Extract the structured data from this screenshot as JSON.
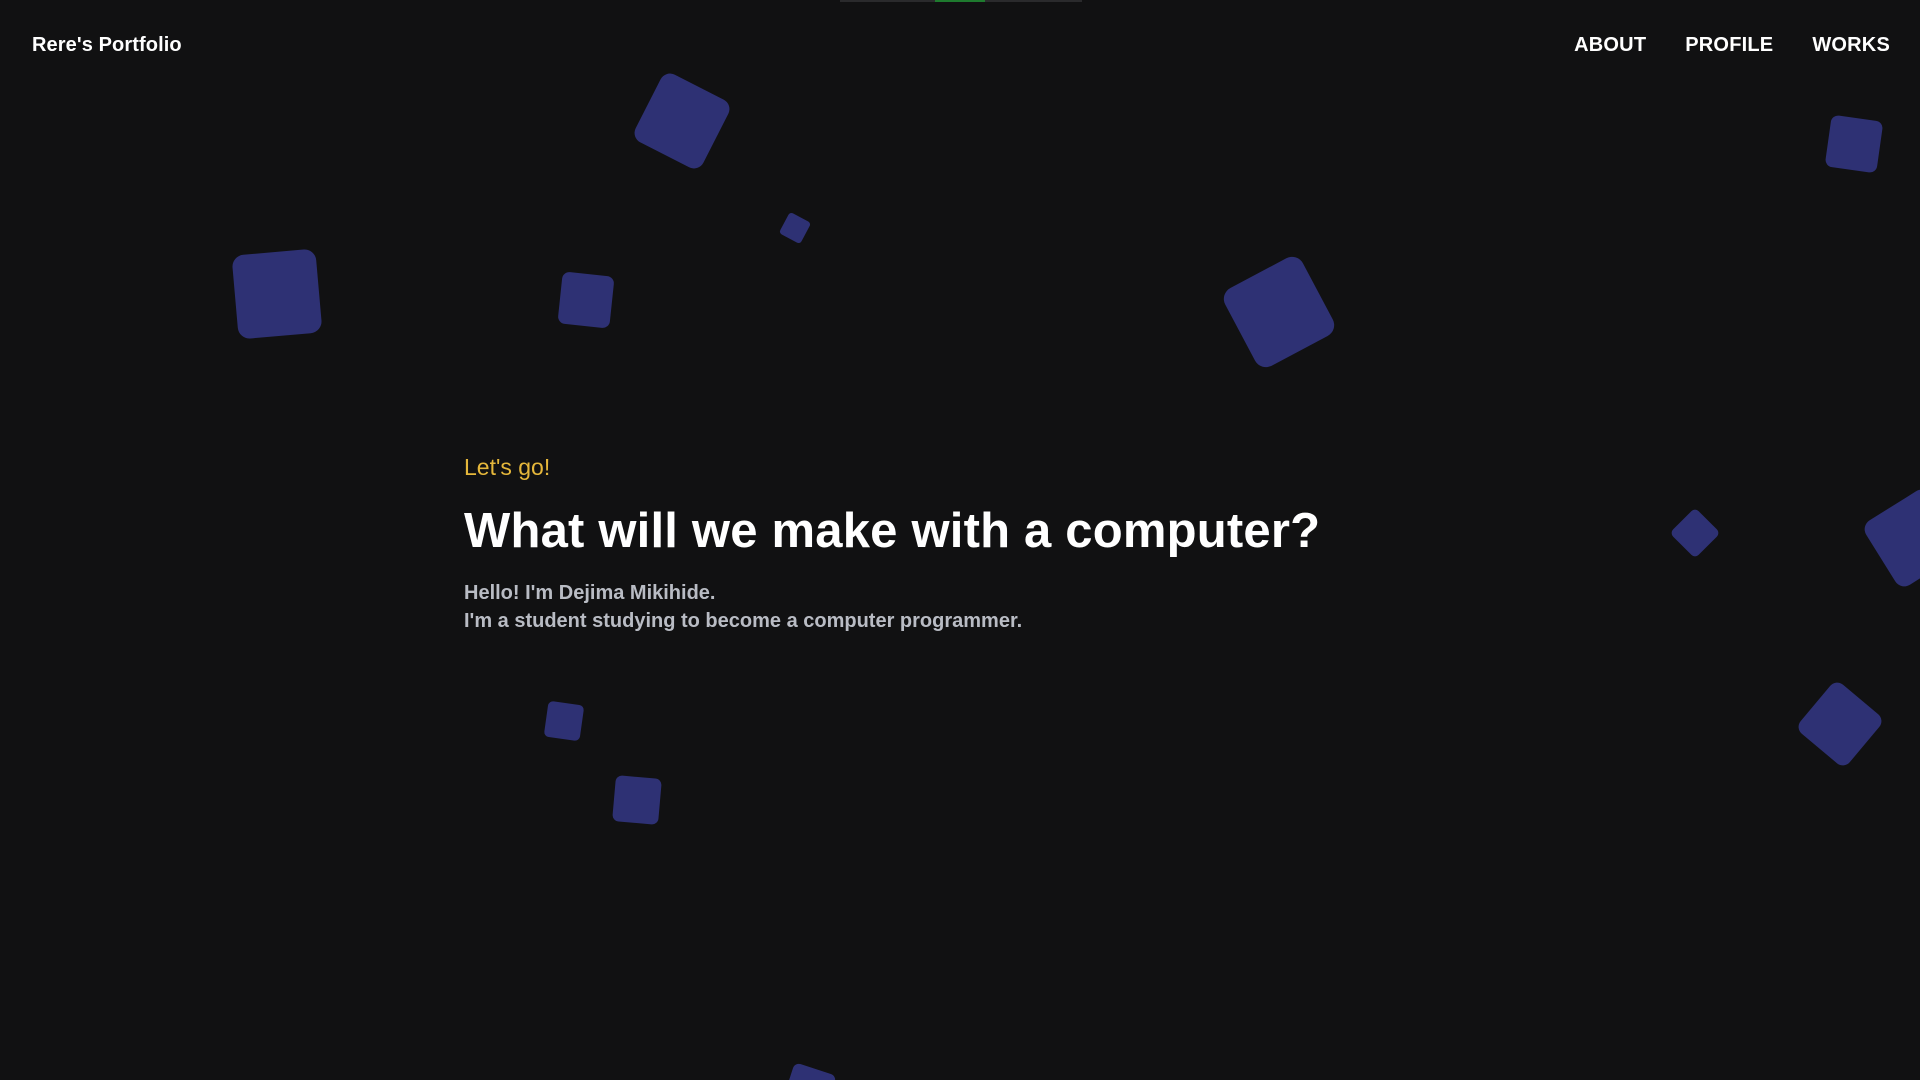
{
  "header": {
    "brand": "Rere's Portfolio",
    "nav": [
      {
        "label": "ABOUT"
      },
      {
        "label": "PROFILE"
      },
      {
        "label": "WORKS"
      }
    ]
  },
  "hero": {
    "kicker": "Let's go!",
    "title": "What will we make with a computer?",
    "lines": [
      "Hello! I'm Dejima Mikihide.",
      "I'm a student studying to become a computer programmer."
    ]
  },
  "colors": {
    "background": "#111112",
    "accent_kicker": "#e5b73b",
    "cube": "#2e3174",
    "text_primary": "#ffffff",
    "text_secondary": "#b9bcc4",
    "progress_fill": "#1e7a2e"
  }
}
